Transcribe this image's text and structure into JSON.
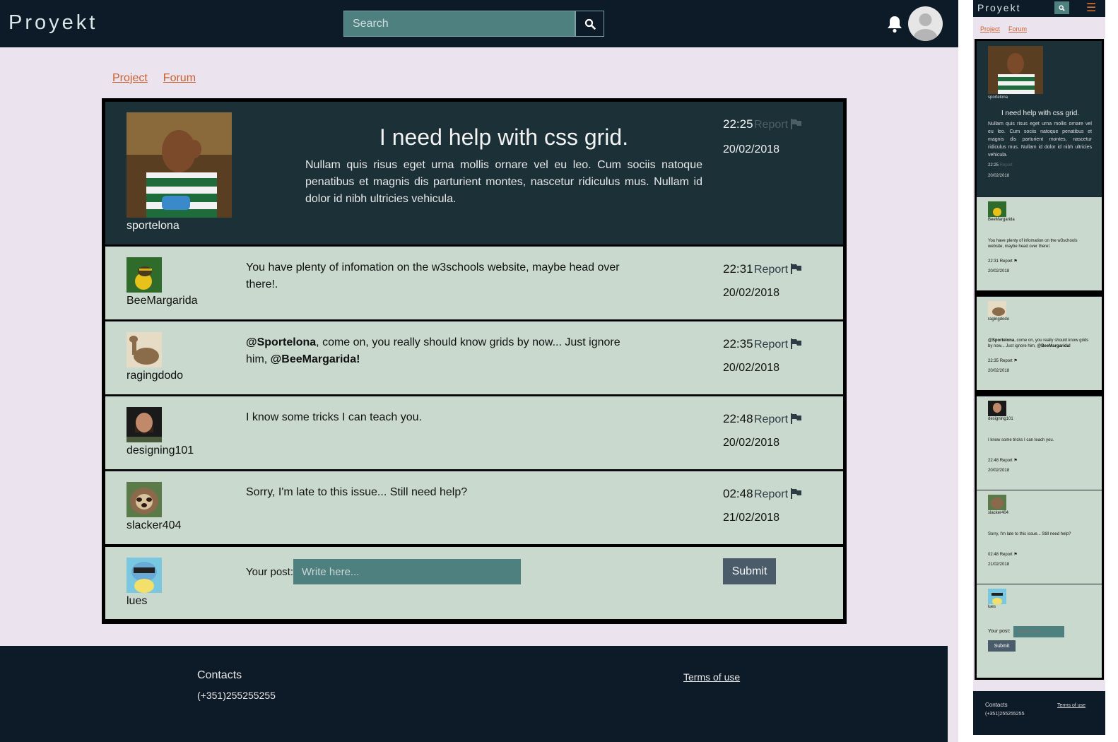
{
  "header": {
    "logo": "Proyekt",
    "search_placeholder": "Search"
  },
  "breadcrumb": [
    "Project",
    "Forum"
  ],
  "thread": {
    "author": "sportelona",
    "title": "I need help with css grid.",
    "body": "Nullam quis risus eget urna mollis ornare vel eu leo. Cum sociis natoque penatibus et magnis dis parturient montes, nascetur ridiculus mus. Nullam id dolor id nibh ultricies vehicula.",
    "time": "22:25",
    "date": "20/02/2018",
    "report_label": "Report"
  },
  "replies": [
    {
      "user": "BeeMargarida",
      "text": "You have plenty of infomation on the w3schools website, maybe head over there!.",
      "time": "22:31",
      "date": "20/02/2018",
      "report": "Report"
    },
    {
      "user": "ragingdodo",
      "mention1": "@Sportelona",
      "text": ", come on, you really should know grids by now... Just ignore him, ",
      "mention2": "@BeeMargarida!",
      "time": "22:35",
      "date": "20/02/2018",
      "report": "Report"
    },
    {
      "user": "designing101",
      "text": "I know some tricks I can teach you.",
      "time": "22:48",
      "date": "20/02/2018",
      "report": "Report"
    },
    {
      "user": "slacker404",
      "text": "Sorry, I'm late to this issue... Still need help?",
      "time": "02:48",
      "date": "21/02/2018",
      "report": "Report"
    }
  ],
  "composer": {
    "user": "lues",
    "label": "Your post:",
    "placeholder": "Write here...",
    "submit": "Submit"
  },
  "footer": {
    "contacts": "Contacts",
    "phone": "(+351)255255255",
    "terms": "Terms of use"
  },
  "mobile": {
    "menu_icon": "hamburger-icon"
  }
}
